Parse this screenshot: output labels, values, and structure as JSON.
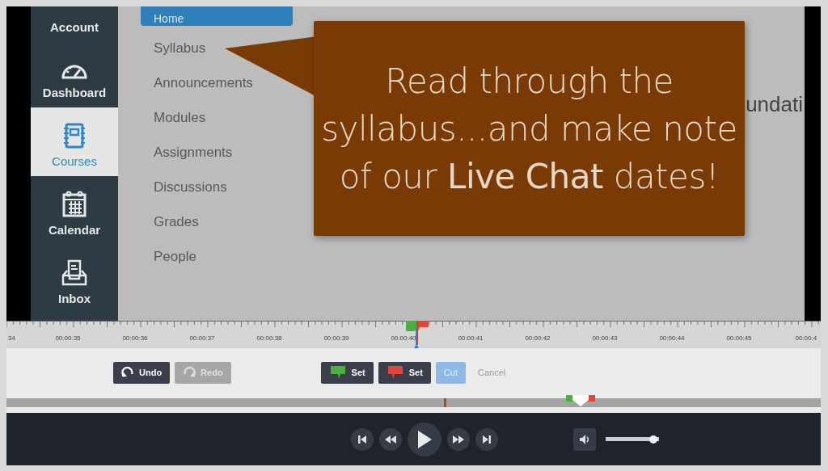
{
  "sidebar": {
    "items": [
      {
        "label": "Account",
        "selected": false
      },
      {
        "label": "Dashboard",
        "selected": false
      },
      {
        "label": "Courses",
        "selected": true
      },
      {
        "label": "Calendar",
        "selected": false
      },
      {
        "label": "Inbox",
        "selected": false
      }
    ]
  },
  "course_nav": {
    "items": [
      {
        "label": "Home",
        "selected": true
      },
      {
        "label": "Syllabus",
        "selected": false
      },
      {
        "label": "Announcements",
        "selected": false
      },
      {
        "label": "Modules",
        "selected": false
      },
      {
        "label": "Assignments",
        "selected": false
      },
      {
        "label": "Discussions",
        "selected": false
      },
      {
        "label": "Grades",
        "selected": false
      },
      {
        "label": "People",
        "selected": false
      }
    ]
  },
  "page_heading": "undati",
  "callout": {
    "text": "Read through the syllabus...and make note of our **Live Chat** dates!"
  },
  "timeline": {
    "labels": [
      "34",
      "00:00:35",
      "00:00:36",
      "00:00:37",
      "00:00:38",
      "00:00:39",
      "00:00:40",
      "00:00:41",
      "00:00:42",
      "00:00:43",
      "00:00:44",
      "00:00:45",
      "00:00:4"
    ]
  },
  "edit_toolbar": {
    "history": [
      {
        "label": "Undo",
        "disabled": false
      },
      {
        "label": "Redo",
        "disabled": true
      }
    ],
    "markers": [
      {
        "label": "Set",
        "color": "#4caf3f"
      },
      {
        "label": "Set",
        "color": "#e0463c"
      }
    ],
    "cut": {
      "label": "Cut",
      "disabled": true
    },
    "cancel": {
      "label": "Cancel"
    }
  },
  "player": {
    "volume": {
      "level": 0.97
    }
  }
}
